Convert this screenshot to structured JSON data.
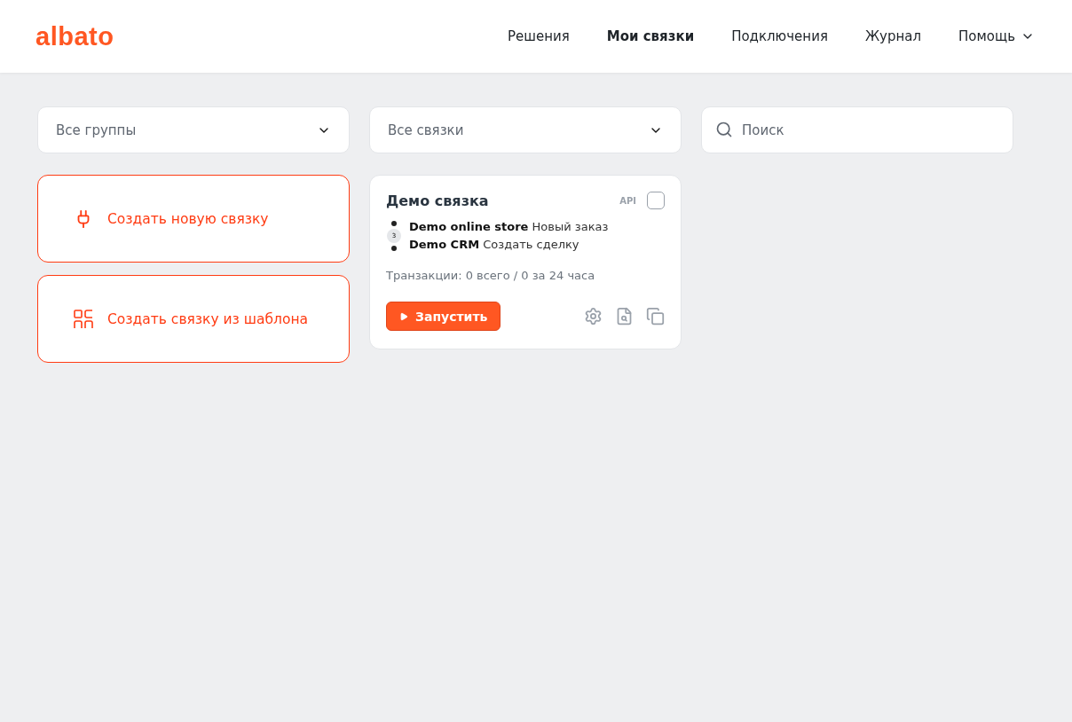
{
  "header": {
    "logo": "albato",
    "nav": [
      {
        "label": "Решения",
        "selected": false,
        "dropdown": false
      },
      {
        "label": "Мои связки",
        "selected": true,
        "dropdown": false
      },
      {
        "label": "Подключения",
        "selected": false,
        "dropdown": false
      },
      {
        "label": "Журнал",
        "selected": false,
        "dropdown": false
      },
      {
        "label": "Помощь",
        "selected": false,
        "dropdown": true
      }
    ]
  },
  "filters": {
    "group_select": "Все группы",
    "bundle_select": "Все связки",
    "search": {
      "placeholder": "Поиск"
    }
  },
  "actions": [
    {
      "kind": "new",
      "label": "Создать новую связку"
    },
    {
      "kind": "template",
      "label": "Создать связку из шаблона"
    }
  ],
  "bundles": [
    {
      "title": "Демо связка",
      "badge": "API",
      "checked": false,
      "steps_count": "3",
      "steps": [
        {
          "app": "Demo online store",
          "action": "Новый заказ"
        },
        {
          "app": "Demo CRM",
          "action": "Создать сделку"
        }
      ],
      "transactions": "Транзакции: 0 всего / 0 за 24 часа",
      "run_button": "Запустить"
    }
  ]
}
